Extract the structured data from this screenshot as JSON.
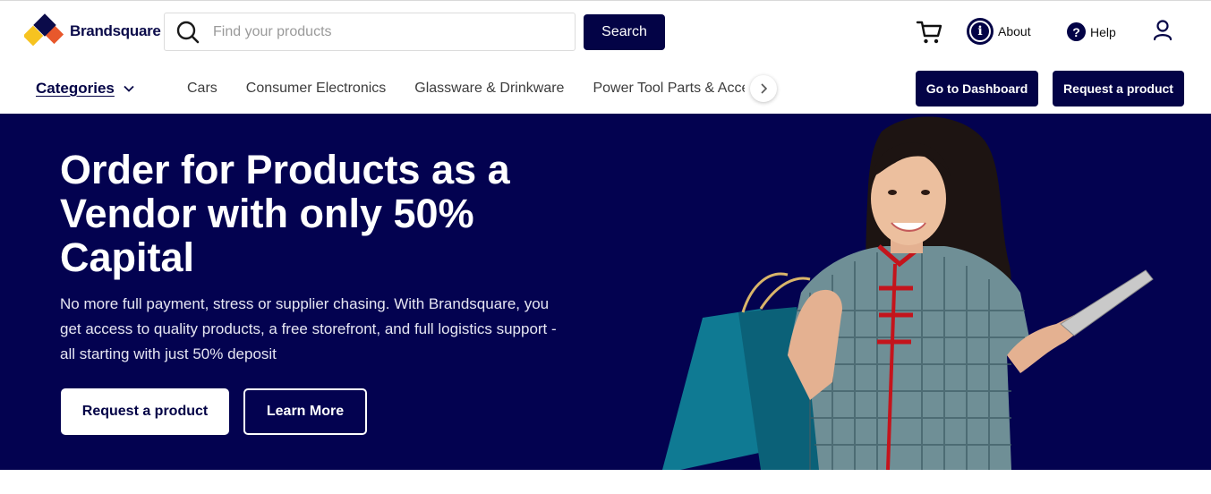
{
  "brand": {
    "name": "Brandsquare"
  },
  "search": {
    "placeholder": "Find your products",
    "button_label": "Search"
  },
  "header": {
    "about_label": "About",
    "help_label": "Help"
  },
  "nav": {
    "categories_label": "Categories",
    "links": [
      "Cars",
      "Consumer Electronics",
      "Glassware & Drinkware",
      "Power Tool Parts & Accessories"
    ],
    "dashboard_label": "Go to Dashboard",
    "request_label": "Request a product"
  },
  "hero": {
    "title": "Order for Products as a Vendor with only 50% Capital",
    "description": "No more full payment, stress or supplier chasing. With Brandsquare, you get access to quality products, a free storefront, and full logistics support - all starting with just 50% deposit",
    "primary_button": "Request a product",
    "secondary_button": "Learn More"
  },
  "colors": {
    "primary": "#030346",
    "hero_bg": "#030250",
    "logo_orange": "#e8582c",
    "logo_yellow": "#f6c320",
    "bag_teal": "#0f7a93",
    "dress_red": "#c4141c"
  },
  "icons": {
    "search": "magnifier-icon",
    "cart": "cart-icon",
    "about": "info-icon",
    "help": "question-icon",
    "user": "user-icon",
    "categories": "chevron-down-icon",
    "nav_next": "chevron-right-icon"
  }
}
